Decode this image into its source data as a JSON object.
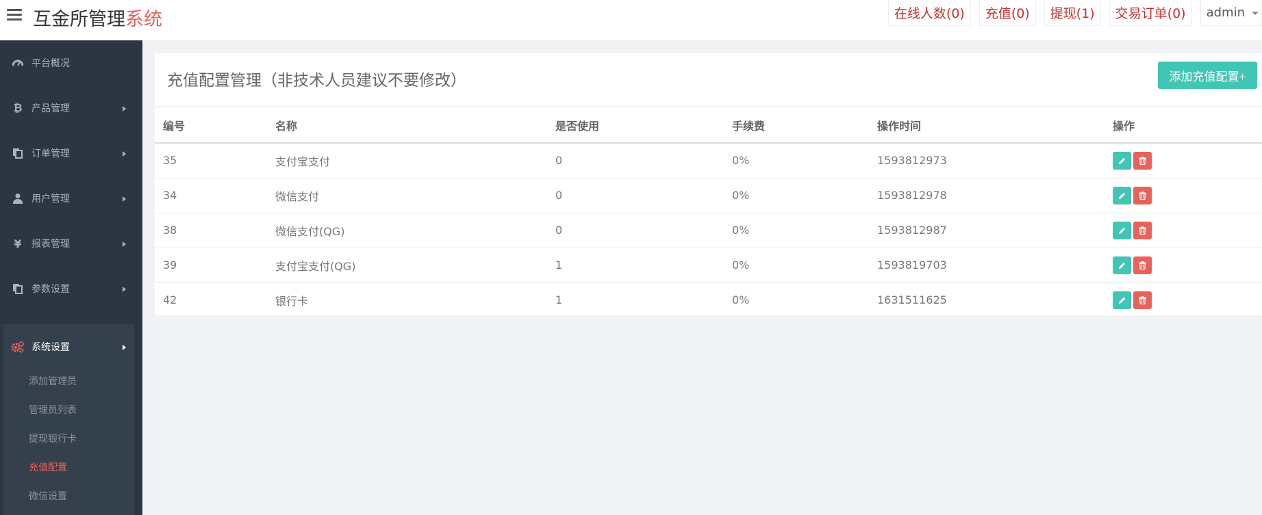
{
  "header": {
    "brand_main": "互金所管理",
    "brand_accent": "系统",
    "nav": [
      {
        "label": "在线人数(0)"
      },
      {
        "label": "充值(0)"
      },
      {
        "label": "提现(1)"
      },
      {
        "label": "交易订单(0)"
      }
    ],
    "user": "admin"
  },
  "sidebar": {
    "items": [
      {
        "label": "平台概况",
        "icon": "dashboard-icon"
      },
      {
        "label": "产品管理",
        "icon": "bitcoin-icon"
      },
      {
        "label": "订单管理",
        "icon": "copy-icon"
      },
      {
        "label": "用户管理",
        "icon": "user-icon"
      },
      {
        "label": "报表管理",
        "icon": "yen-icon"
      },
      {
        "label": "参数设置",
        "icon": "copy-icon"
      },
      {
        "label": "系统设置",
        "icon": "gears-icon"
      }
    ],
    "submenu": [
      {
        "label": "添加管理员"
      },
      {
        "label": "管理员列表"
      },
      {
        "label": "提现银行卡"
      },
      {
        "label": "充值配置"
      },
      {
        "label": "微信设置"
      }
    ]
  },
  "main": {
    "title": "充值配置管理（非技术人员建议不要修改）",
    "add_button": "添加充值配置+",
    "columns": [
      "编号",
      "名称",
      "是否使用",
      "手续费",
      "操作时间",
      "操作"
    ],
    "rows": [
      {
        "id": "35",
        "name": "支付宝支付",
        "used": "0",
        "fee": "0%",
        "time": "1593812973"
      },
      {
        "id": "34",
        "name": "微信支付",
        "used": "0",
        "fee": "0%",
        "time": "1593812978"
      },
      {
        "id": "38",
        "name": "微信支付(QG)",
        "used": "0",
        "fee": "0%",
        "time": "1593812987"
      },
      {
        "id": "39",
        "name": "支付宝支付(QG)",
        "used": "1",
        "fee": "0%",
        "time": "1593819703"
      },
      {
        "id": "42",
        "name": "银行卡",
        "used": "1",
        "fee": "0%",
        "time": "1631511625"
      }
    ]
  },
  "colors": {
    "accent": "#e8625a",
    "teal": "#41c5b4",
    "sidebar_bg": "#2c3642",
    "nav_red": "#c9302c"
  }
}
